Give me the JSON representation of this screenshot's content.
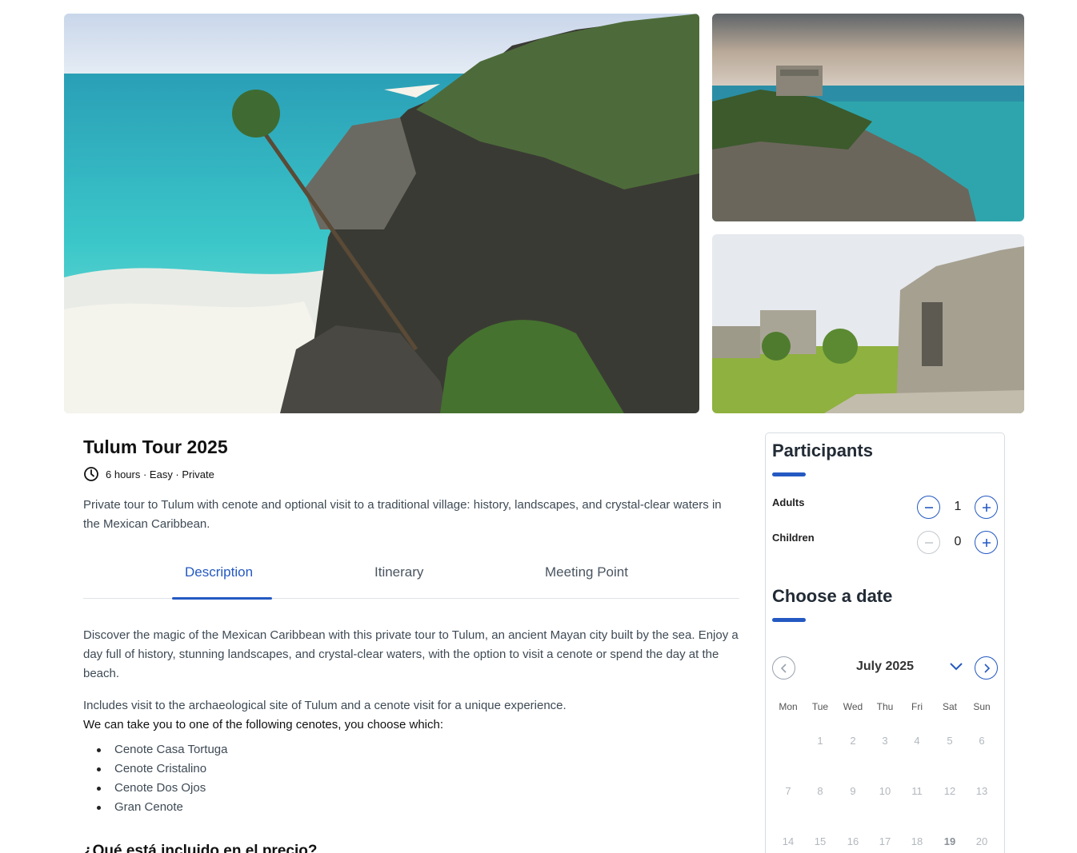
{
  "tour": {
    "title": "Tulum Tour 2025",
    "meta": "6 hours · Easy · Private",
    "summary": "Private tour to Tulum with cenote and optional visit to a traditional village: history, landscapes, and crystal-clear waters in the Mexican Caribbean."
  },
  "tabs": [
    {
      "label": "Description",
      "active": true
    },
    {
      "label": "Itinerary",
      "active": false
    },
    {
      "label": "Meeting Point",
      "active": false
    }
  ],
  "description": {
    "intro": "Discover the magic of the Mexican Caribbean with this private tour to Tulum, an ancient Mayan city built by the sea. Enjoy a day full of history, stunning landscapes, and crystal-clear waters, with the option to visit a cenote or spend the day at the beach.",
    "includes": "Includes visit to the archaeological site of Tulum and a cenote visit for a unique experience.",
    "choose_line": "We can take you to one of the following cenotes, you choose which:",
    "cenotes": [
      "Cenote Casa Tortuga",
      "Cenote Cristalino",
      "Cenote Dos Ojos",
      "Gran Cenote"
    ],
    "included_title": "¿Qué está incluido en el precio?"
  },
  "participants": {
    "title": "Participants",
    "adults": {
      "label": "Adults",
      "value": "1"
    },
    "children": {
      "label": "Children",
      "value": "0"
    }
  },
  "calendar": {
    "title": "Choose a date",
    "month": "July 2025",
    "weekdays": [
      "Mon",
      "Tue",
      "Wed",
      "Thu",
      "Fri",
      "Sat",
      "Sun"
    ],
    "days": [
      "1",
      "2",
      "3",
      "4",
      "5",
      "6",
      "7",
      "8",
      "9",
      "10",
      "11",
      "12",
      "13",
      "14",
      "15",
      "16",
      "17",
      "18",
      "19",
      "20"
    ],
    "highlighted_day": "19"
  },
  "colors": {
    "accent": "#2459c2",
    "text": "#3e4a55",
    "border": "#d8dde3"
  },
  "icons": [
    "clock-icon",
    "minus-icon",
    "plus-icon",
    "chevron-left-icon",
    "chevron-right-icon",
    "chevron-down-icon"
  ]
}
